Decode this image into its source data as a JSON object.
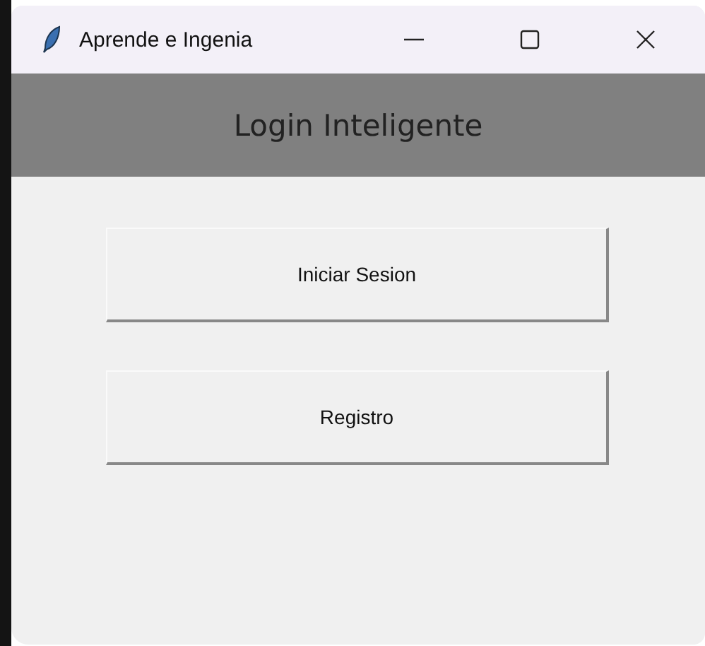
{
  "window": {
    "title": "Aprende e Ingenia"
  },
  "header": {
    "title": "Login Inteligente"
  },
  "buttons": [
    {
      "label": "Iniciar Sesion"
    },
    {
      "label": "Registro"
    }
  ]
}
